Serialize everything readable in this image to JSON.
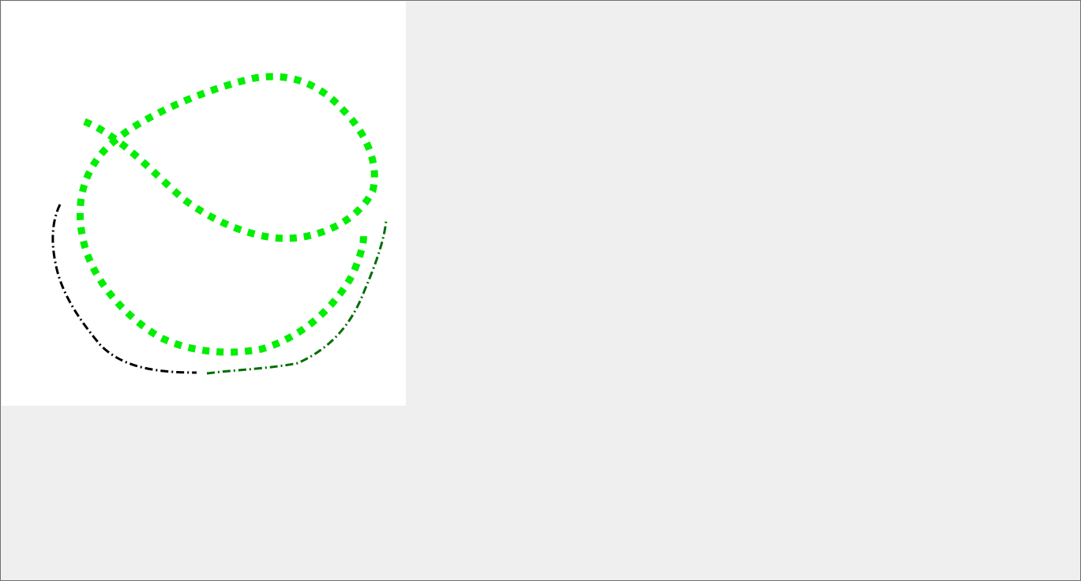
{
  "window": {
    "background_color": "#efefef",
    "border_color": "#6f6f6f"
  },
  "canvas": {
    "background_color": "#ffffff",
    "strokes": [
      {
        "id": "big-loop",
        "color": "#00ee00",
        "style": "dotted"
      },
      {
        "id": "curve-left",
        "color": "#000000",
        "style": "dash-dot"
      },
      {
        "id": "curve-right",
        "color": "#006e00",
        "style": "dash-dot"
      }
    ]
  }
}
